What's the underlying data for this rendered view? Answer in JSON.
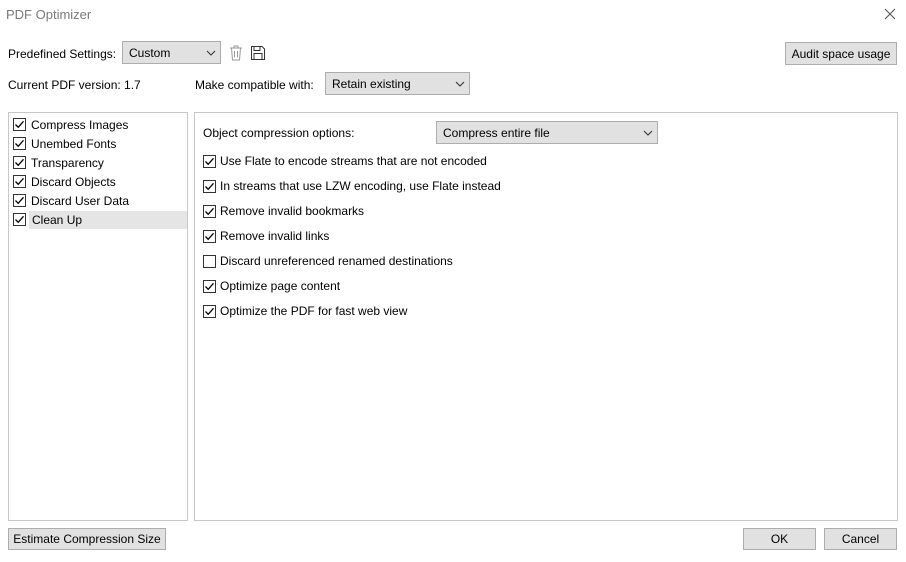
{
  "window": {
    "title": "PDF Optimizer"
  },
  "header": {
    "predefined_label": "Predefined Settings:",
    "predefined_value": "Custom",
    "audit_button": "Audit space usage",
    "version_label": "Current PDF version: 1.7",
    "compat_label": "Make compatible with:",
    "compat_value": "Retain existing"
  },
  "sidebar": {
    "items": [
      {
        "label": "Compress Images",
        "checked": true
      },
      {
        "label": "Unembed Fonts",
        "checked": true
      },
      {
        "label": "Transparency",
        "checked": true
      },
      {
        "label": "Discard Objects",
        "checked": true
      },
      {
        "label": "Discard User Data",
        "checked": true
      },
      {
        "label": "Clean Up",
        "checked": true,
        "selected": true
      }
    ]
  },
  "main": {
    "compression_label": "Object compression options:",
    "compression_value": "Compress entire file",
    "options": [
      {
        "label": "Use Flate to encode streams that are not encoded",
        "checked": true
      },
      {
        "label": "In streams that use LZW encoding, use Flate instead",
        "checked": true
      },
      {
        "label": "Remove invalid bookmarks",
        "checked": true
      },
      {
        "label": "Remove invalid links",
        "checked": true
      },
      {
        "label": "Discard unreferenced renamed destinations",
        "checked": false
      },
      {
        "label": "Optimize page content",
        "checked": true
      },
      {
        "label": "Optimize the PDF for fast web view",
        "checked": true
      }
    ]
  },
  "footer": {
    "estimate_button": "Estimate Compression Size",
    "ok_button": "OK",
    "cancel_button": "Cancel"
  },
  "icons": {
    "close": "close-icon",
    "delete": "trash-icon",
    "save": "save-icon",
    "dropdown": "chevron-down-icon",
    "check": "checkmark-icon"
  }
}
